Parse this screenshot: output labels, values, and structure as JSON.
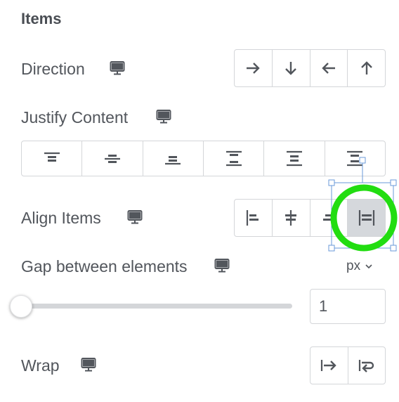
{
  "section": {
    "title": "Items"
  },
  "direction": {
    "label": "Direction",
    "icon": "monitor-icon",
    "options": [
      "arrow-right-icon",
      "arrow-down-icon",
      "arrow-left-icon",
      "arrow-up-icon"
    ]
  },
  "justify": {
    "label": "Justify Content",
    "icon": "monitor-icon",
    "options": [
      "justify-start-icon",
      "justify-center-icon",
      "justify-end-icon",
      "justify-space-between-icon",
      "justify-space-around-icon",
      "justify-space-evenly-icon"
    ]
  },
  "align": {
    "label": "Align Items",
    "icon": "monitor-icon",
    "options": [
      "align-start-icon",
      "align-center-icon",
      "align-end-icon",
      "align-stretch-icon"
    ],
    "selected": "align-stretch-icon",
    "highlight_color": "#22dd11"
  },
  "gap": {
    "label": "Gap between elements",
    "icon": "monitor-icon",
    "unit": "px",
    "value": "1",
    "slider_value": 1
  },
  "wrap": {
    "label": "Wrap",
    "icon": "monitor-icon",
    "options": [
      "no-wrap-icon",
      "wrap-icon"
    ]
  },
  "colors": {
    "text": "#52565c",
    "border": "#d4d6d9",
    "active_bg": "#d5d8dc",
    "selection": "#6a9ad8"
  }
}
